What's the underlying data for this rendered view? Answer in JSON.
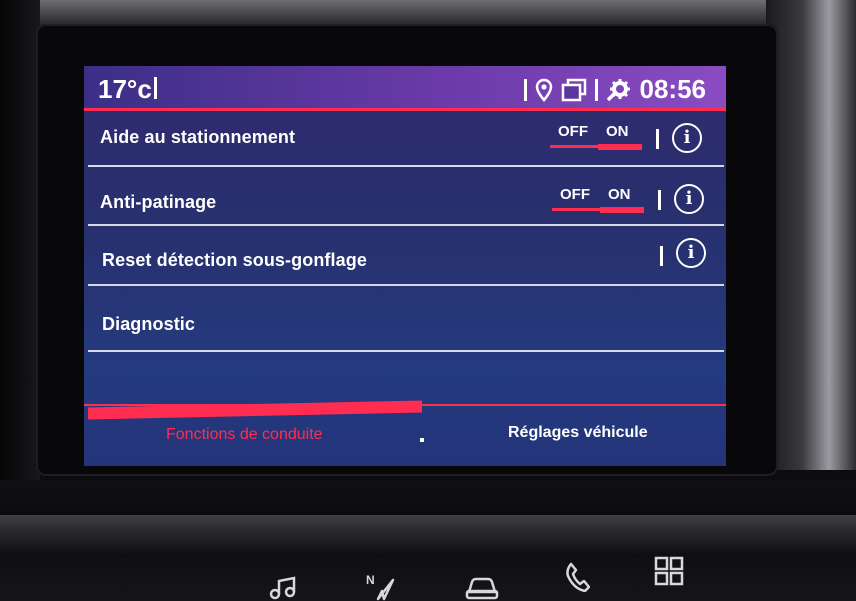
{
  "status": {
    "temperature": "17°c",
    "time": "08:56",
    "icons": [
      "location-icon",
      "screens-icon",
      "settings-gear-icon"
    ]
  },
  "settings": [
    {
      "label": "Aide au stationnement",
      "toggle": {
        "off": "OFF",
        "on": "ON",
        "state": "ON"
      },
      "info": "i"
    },
    {
      "label": "Anti-patinage",
      "toggle": {
        "off": "OFF",
        "on": "ON",
        "state": "ON"
      },
      "info": "i"
    },
    {
      "label": "Reset détection sous-gonflage",
      "info": "i"
    },
    {
      "label": "Diagnostic"
    }
  ],
  "tabs": {
    "drive_functions": "Fonctions de conduite",
    "vehicle_settings": "Réglages véhicule",
    "active": "drive_functions"
  },
  "hardware_buttons": [
    "music-icon",
    "navigation-icon",
    "car-icon",
    "phone-icon",
    "apps-grid-icon"
  ],
  "colors": {
    "accent": "#ff2d50",
    "screen_bg": "#2b316f",
    "text": "#ffffff"
  }
}
